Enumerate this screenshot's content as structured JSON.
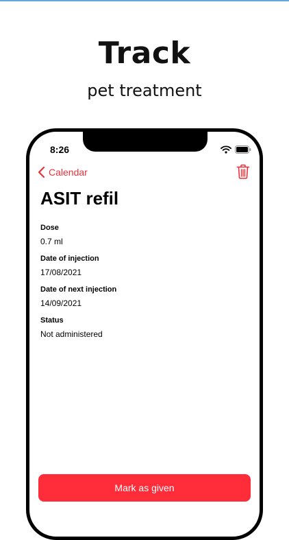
{
  "promo": {
    "headline": "Track",
    "subheadline": "pet treatment"
  },
  "status_bar": {
    "time": "8:26"
  },
  "nav": {
    "back_label": "Calendar"
  },
  "page": {
    "title": "ASIT refil"
  },
  "fields": [
    {
      "label": "Dose",
      "value": "0.7 ml"
    },
    {
      "label": "Date of injection",
      "value": "17/08/2021"
    },
    {
      "label": "Date of next injection",
      "value": "14/09/2021"
    },
    {
      "label": "Status",
      "value": "Not administered"
    }
  ],
  "actions": {
    "primary_label": "Mark as given"
  },
  "colors": {
    "accent": "#e8333c",
    "button": "#ff2d3a"
  },
  "icons": [
    "chevron-left-icon",
    "trash-icon",
    "wifi-icon",
    "battery-icon"
  ]
}
